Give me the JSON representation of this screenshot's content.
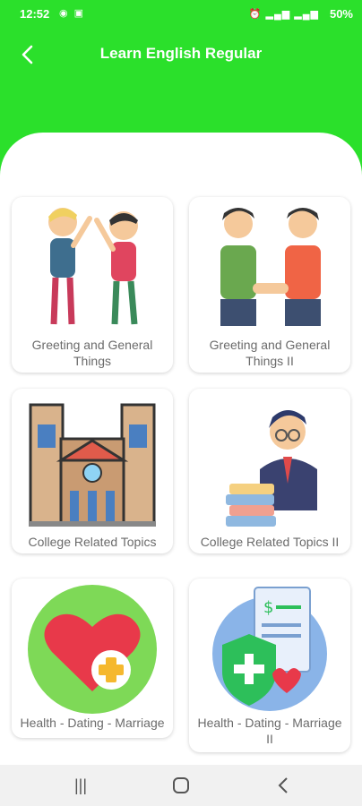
{
  "status": {
    "time": "12:52",
    "battery": "50%"
  },
  "header": {
    "title": "Learn English Regular",
    "bg_color": "#2be02b"
  },
  "cards": [
    {
      "label": "Greeting and General Things",
      "icon": "high-five-people-icon"
    },
    {
      "label": "Greeting and General Things II",
      "icon": "handshake-people-icon"
    },
    {
      "label": "College Related Topics",
      "icon": "college-building-icon"
    },
    {
      "label": "College Related Topics II",
      "icon": "teacher-books-icon"
    },
    {
      "label": "Health - Dating - Marriage",
      "icon": "heart-health-icon"
    },
    {
      "label": "Health - Dating - Marriage II",
      "icon": "health-document-icon"
    }
  ],
  "navbar": {
    "recents_icon": "recents-icon",
    "home_icon": "home-icon",
    "back_icon": "back-icon"
  }
}
